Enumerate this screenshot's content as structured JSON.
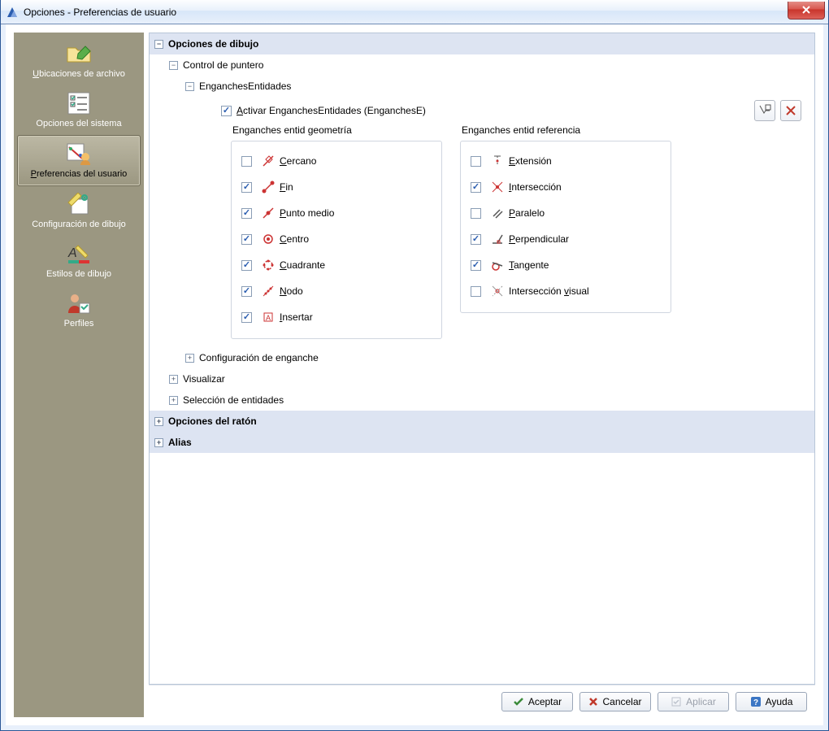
{
  "window": {
    "title": "Opciones - Preferencias de usuario"
  },
  "sidebar": {
    "items": [
      {
        "label": "Ubicaciones de archivo"
      },
      {
        "label": "Opciones del sistema"
      },
      {
        "label": "Preferencias del usuario"
      },
      {
        "label": "Configuración de dibujo"
      },
      {
        "label": "Estilos de dibujo"
      },
      {
        "label": "Perfiles"
      }
    ]
  },
  "tree": {
    "drawing_options": "Opciones de dibujo",
    "pointer_control": "Control de puntero",
    "esnaps": "EnganchesEntidades",
    "enable_label_pre": "A",
    "enable_label_rest": "ctivar EnganchesEntidades (EnganchesE)",
    "geom_title": "Enganches entid geometría",
    "ref_title": "Enganches entid referencia",
    "geom": [
      {
        "name": "nearest",
        "u": "C",
        "rest": "ercano",
        "checked": false
      },
      {
        "name": "end",
        "u": "F",
        "rest": "in",
        "checked": true
      },
      {
        "name": "midpoint",
        "u": "P",
        "rest": "unto medio",
        "checked": true
      },
      {
        "name": "center",
        "u": "C",
        "rest": "entro",
        "checked": true
      },
      {
        "name": "quadrant",
        "u": "C",
        "rest": "uadrante",
        "checked": true
      },
      {
        "name": "node",
        "u": "N",
        "rest": "odo",
        "checked": true
      },
      {
        "name": "insert",
        "u": "I",
        "rest": "nsertar",
        "checked": true
      }
    ],
    "ref": [
      {
        "name": "extension",
        "u": "E",
        "rest": "xtensión",
        "checked": false
      },
      {
        "name": "intersection",
        "u": "I",
        "rest": "ntersección",
        "checked": true
      },
      {
        "name": "parallel",
        "u": "P",
        "rest": "aralelo",
        "checked": false
      },
      {
        "name": "perpendicular",
        "u": "P",
        "rest": "erpendicular",
        "checked": true
      },
      {
        "name": "tangent",
        "u": "T",
        "rest": "angente",
        "checked": true
      },
      {
        "name": "visual_x",
        "label": "Intersección visual",
        "checked": false,
        "uindex": 13
      }
    ],
    "snap_config": "Configuración de enganche",
    "display": "Visualizar",
    "entity_selection": "Selección de entidades",
    "mouse_options": "Opciones del ratón",
    "alias": "Alias"
  },
  "footer": {
    "ok": "Aceptar",
    "cancel": "Cancelar",
    "apply": "Aplicar",
    "help": "Ayuda"
  }
}
